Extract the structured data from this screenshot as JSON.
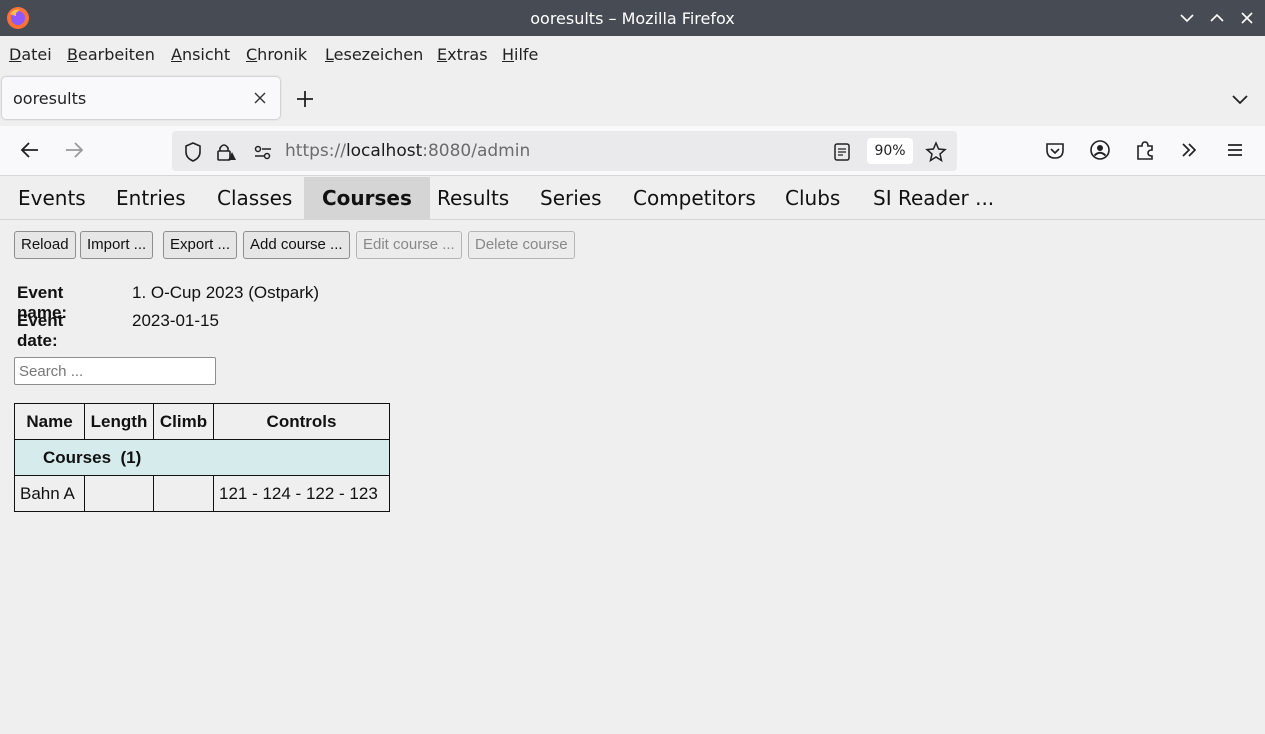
{
  "window": {
    "title": "ooresults – Mozilla Firefox"
  },
  "menu": {
    "items": [
      {
        "label": "Datei",
        "accel": "D"
      },
      {
        "label": "Bearbeiten",
        "accel": "B"
      },
      {
        "label": "Ansicht",
        "accel": "A"
      },
      {
        "label": "Chronik",
        "accel": "C"
      },
      {
        "label": "Lesezeichen",
        "accel": "L"
      },
      {
        "label": "Extras",
        "accel": "E"
      },
      {
        "label": "Hilfe",
        "accel": "H"
      }
    ]
  },
  "tab": {
    "title": "ooresults"
  },
  "url": {
    "scheme": "https://",
    "host": "localhost",
    "rest": ":8080/admin",
    "zoom": "90%"
  },
  "app_nav": {
    "items": [
      "Events",
      "Entries",
      "Classes",
      "Courses",
      "Results",
      "Series",
      "Competitors",
      "Clubs",
      "SI Reader ..."
    ],
    "active": "Courses"
  },
  "toolbar": {
    "reload": "Reload",
    "import": "Import ...",
    "export": "Export ...",
    "add": "Add course ...",
    "edit": "Edit course ...",
    "delete": "Delete course"
  },
  "event": {
    "name_label": "Event name:",
    "name": "1. O-Cup 2023 (Ostpark)",
    "date_label": "Event date:",
    "date": "2023-01-15"
  },
  "search": {
    "placeholder": "Search ..."
  },
  "table": {
    "headers": {
      "name": "Name",
      "length": "Length",
      "climb": "Climb",
      "controls": "Controls"
    },
    "group": "Courses  (1)",
    "rows": [
      {
        "name": "Bahn A",
        "length": "",
        "climb": "",
        "controls": "121 - 124 - 122 - 123"
      }
    ]
  },
  "colors": {
    "titlebar": "#474c54",
    "active_nav": "#d5d5d5",
    "group_row": "#d6ecec"
  }
}
